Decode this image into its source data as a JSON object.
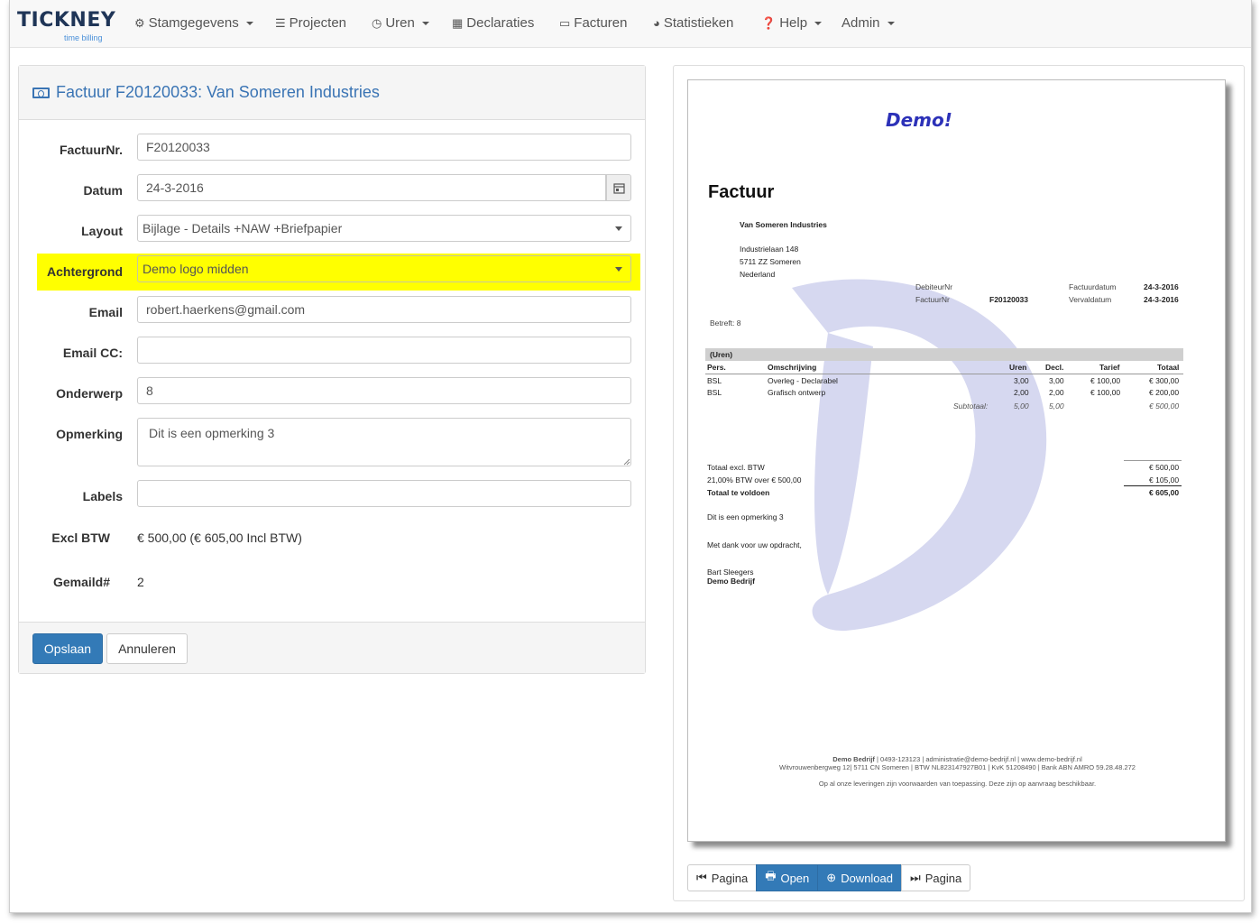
{
  "brand": {
    "name_pre": "TI",
    "name_mid": "CK",
    "name_post": "NEY",
    "tagline": "time billing"
  },
  "nav": [
    {
      "label": "Stamgegevens",
      "icon": "cogs-icon",
      "dropdown": true
    },
    {
      "label": "Projecten",
      "icon": "list-icon",
      "dropdown": false
    },
    {
      "label": "Uren",
      "icon": "clock-icon",
      "dropdown": true
    },
    {
      "label": "Declaraties",
      "icon": "calculator-icon",
      "dropdown": false
    },
    {
      "label": "Facturen",
      "icon": "money-icon",
      "dropdown": false
    },
    {
      "label": "Statistieken",
      "icon": "pie-chart-icon",
      "dropdown": false
    },
    {
      "label": "Help",
      "icon": "question-icon",
      "dropdown": true
    },
    {
      "label": "Admin",
      "icon": "",
      "dropdown": true
    }
  ],
  "form": {
    "title": "Factuur F20120033: Van Someren Industries",
    "factuurnr": {
      "label": "FactuurNr.",
      "value": "F20120033"
    },
    "datum": {
      "label": "Datum",
      "value": "24-3-2016"
    },
    "layout": {
      "label": "Layout",
      "value": "Bijlage - Details +NAW +Briefpapier"
    },
    "achtergrond": {
      "label": "Achtergrond",
      "value": "Demo logo midden",
      "highlight_color": "#ffff00"
    },
    "email": {
      "label": "Email",
      "value": "robert.haerkens@gmail.com"
    },
    "email_cc": {
      "label": "Email CC:",
      "value": ""
    },
    "onderwerp": {
      "label": "Onderwerp",
      "value": "8"
    },
    "opmerking": {
      "label": "Opmerking",
      "value": "Dit is een opmerking 3"
    },
    "labels": {
      "label": "Labels",
      "value": ""
    },
    "excl_btw": {
      "label": "Excl BTW",
      "value": "€ 500,00 (€ 605,00 Incl BTW)"
    },
    "gemaild": {
      "label": "Gemaild#",
      "value": "2"
    },
    "save_label": "Opslaan",
    "cancel_label": "Annuleren"
  },
  "invoice": {
    "logo_text": "Demo!",
    "title": "Factuur",
    "customer": "Van Someren Industries",
    "address1": "Industrielaan 148",
    "address2": "5711 ZZ Someren",
    "country": "Nederland",
    "debiteur_label": "DebiteurNr",
    "debiteur_value": "",
    "factuurnr_label": "FactuurNr",
    "factuurnr_value": "F20120033",
    "factuurdatum_label": "Factuurdatum",
    "factuurdatum_value": "24-3-2016",
    "vervaldatum_label": "Vervaldatum",
    "vervaldatum_value": "24-3-2016",
    "betreft": "Betreft:  8",
    "section": "(Uren)",
    "columns": {
      "pers": "Pers.",
      "omschrijving": "Omschrijving",
      "uren": "Uren",
      "decl": "Decl.",
      "tarief": "Tarief",
      "totaal": "Totaal"
    },
    "rows": [
      {
        "pers": "BSL",
        "omschrijving": "Overleg - Declarabel",
        "uren": "3,00",
        "decl": "3,00",
        "tarief": "€ 100,00",
        "totaal": "€ 300,00"
      },
      {
        "pers": "BSL",
        "omschrijving": "Grafisch ontwerp",
        "uren": "2,00",
        "decl": "2,00",
        "tarief": "€ 100,00",
        "totaal": "€ 200,00"
      }
    ],
    "subtotal": {
      "label": "Subtotaal:",
      "uren": "5,00",
      "decl": "5,00",
      "totaal": "€ 500,00"
    },
    "totals": [
      {
        "label": "Totaal excl. BTW",
        "value": "€ 500,00"
      },
      {
        "label": "21,00% BTW over € 500,00",
        "value": "€ 105,00"
      },
      {
        "label": "Totaal te voldoen",
        "value": "€ 605,00"
      }
    ],
    "remark": "Dit is een opmerking 3",
    "thanks": "Met dank voor uw opdracht,",
    "signer": "Bart Sleegers",
    "company": "Demo Bedrijf",
    "footer_company": "Demo Bedrijf",
    "footer_line1": " | 0493-123123 | administratie@demo-bedrijf.nl | www.demo-bedrijf.nl",
    "footer_line2": "Witvrouwenbergweg 12| 5711 CN Someren | BTW NL823147927B01 | KvK 51208490 | Bank ABN AMRO 59.28.48.272",
    "footer_line3": "Op al onze leveringen zijn voorwaarden van toepassing. Deze zijn op aanvraag beschikbaar."
  },
  "pager": {
    "prev": "Pagina",
    "open": "Open",
    "download": "Download",
    "next": "Pagina"
  }
}
